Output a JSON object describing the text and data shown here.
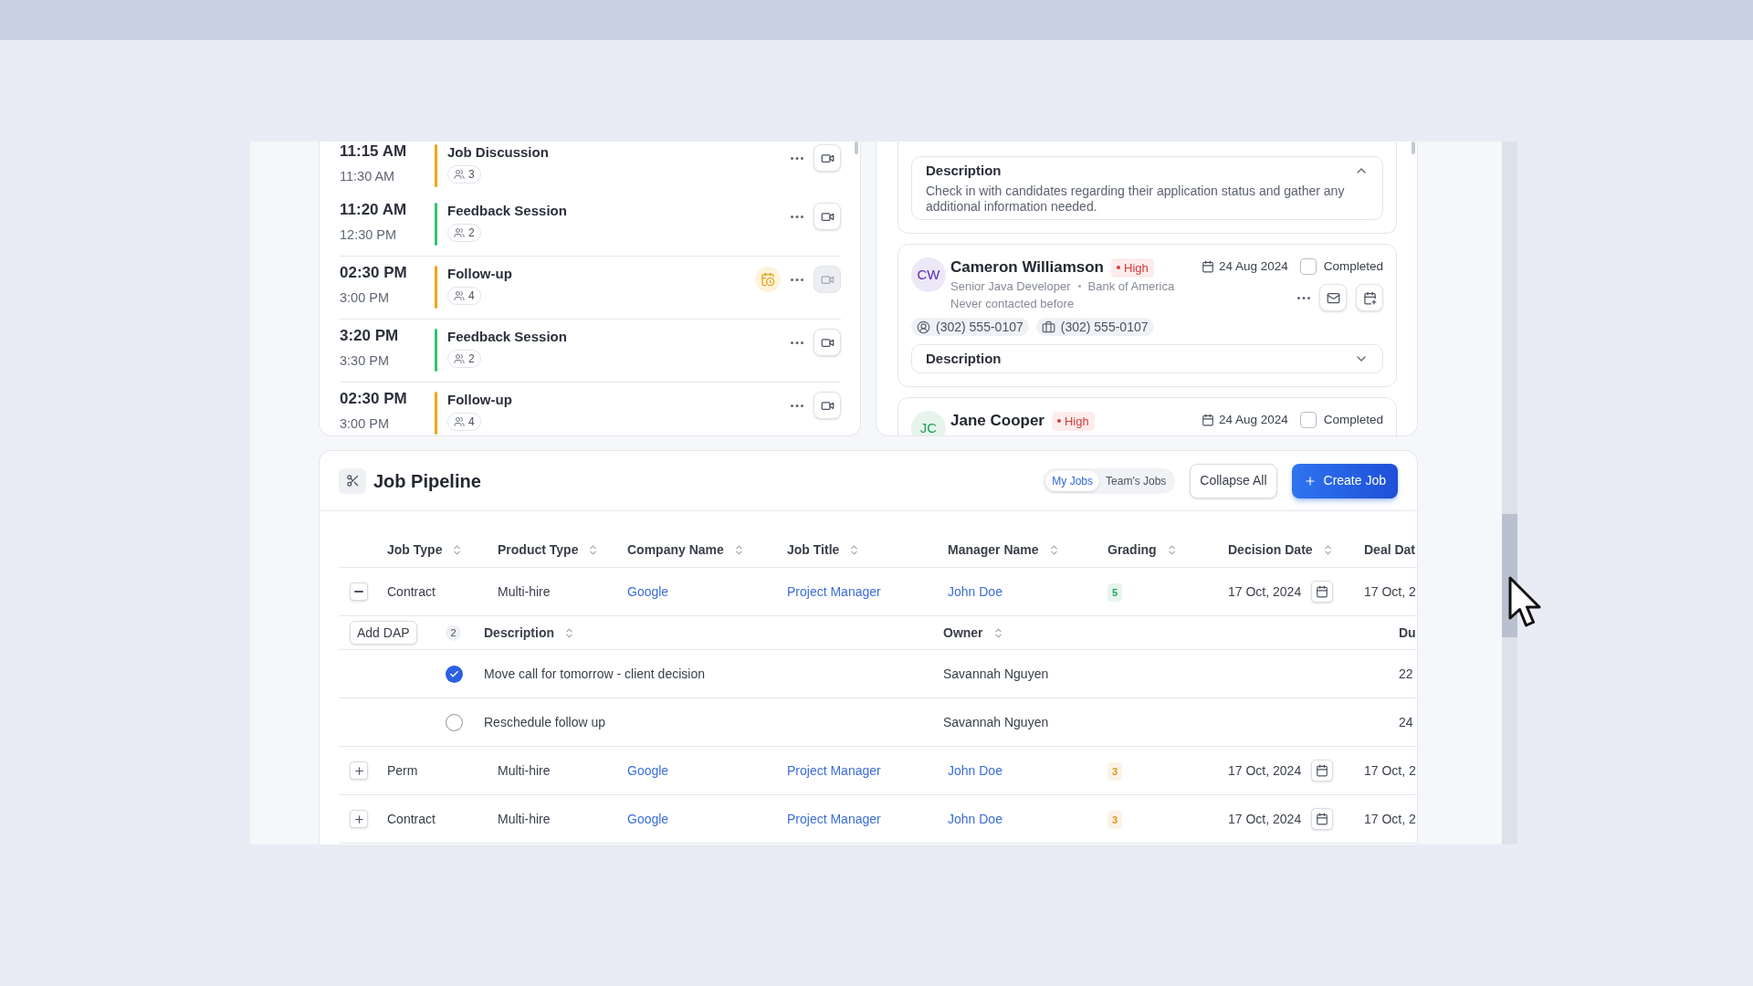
{
  "schedule": {
    "groups": [
      {
        "events": [
          {
            "start": "11:15 AM",
            "end": "11:30 AM",
            "title": "Job Discussion",
            "attendees": "3",
            "color": "#f2a516",
            "flagged": false,
            "video_enabled": true
          },
          {
            "start": "11:20 AM",
            "end": "12:30 PM",
            "title": "Feedback Session",
            "attendees": "2",
            "color": "#2fc46e",
            "flagged": false,
            "video_enabled": true
          }
        ]
      },
      {
        "events": [
          {
            "start": "02:30 PM",
            "end": "3:00 PM",
            "title": "Follow-up",
            "attendees": "4",
            "color": "#f2a516",
            "flagged": true,
            "video_enabled": false
          }
        ]
      },
      {
        "events": [
          {
            "start": "3:20 PM",
            "end": "3:30 PM",
            "title": "Feedback Session",
            "attendees": "2",
            "color": "#2fc46e",
            "flagged": false,
            "video_enabled": true
          }
        ]
      },
      {
        "events": [
          {
            "start": "02:30 PM",
            "end": "3:00 PM",
            "title": "Follow-up",
            "attendees": "4",
            "color": "#f2a516",
            "flagged": false,
            "video_enabled": true
          }
        ]
      }
    ]
  },
  "contacts": {
    "cards": [
      {
        "description": {
          "label": "Description",
          "expanded": true,
          "text": "Check in with candidates regarding their application status and gather any additional information needed."
        }
      },
      {
        "initials": "CW",
        "color": "#5b2bb5",
        "name": "Cameron Williamson",
        "priority": "High",
        "date": "24 Aug 2024",
        "completed": false,
        "completed_label": "Completed",
        "role": "Senior Java Developer",
        "company": "Bank of America",
        "last_contact": "Never contacted before",
        "phones": [
          {
            "kind": "personal",
            "number": "(302) 555-0107"
          },
          {
            "kind": "work",
            "number": "(302) 555-0107"
          }
        ],
        "description": {
          "label": "Description",
          "expanded": false
        }
      },
      {
        "initials": "JC",
        "color": "#1f9d55",
        "name": "Jane Cooper",
        "priority": "High",
        "date": "24 Aug 2024",
        "completed": false,
        "completed_label": "Completed"
      }
    ]
  },
  "pipeline": {
    "title": "Job Pipeline",
    "scopes": [
      {
        "label": "My Jobs",
        "selected": true
      },
      {
        "label": "Team's Jobs",
        "selected": false
      }
    ],
    "actions": [
      {
        "kind": "secondary",
        "label": "Collapse All"
      },
      {
        "kind": "primary",
        "label": "Create Job"
      }
    ],
    "table": {
      "columns": [
        {
          "label": "Job Type",
          "sortable": true
        },
        {
          "label": "Product Type",
          "sortable": true
        },
        {
          "label": "Company Name",
          "sortable": true
        },
        {
          "label": "Job Title",
          "sortable": true
        },
        {
          "label": "Manager Name",
          "sortable": true
        },
        {
          "label": "Grading",
          "sortable": true
        },
        {
          "label": "Decision Date",
          "sortable": true
        },
        {
          "label": "Deal Dat",
          "sortable": false
        }
      ],
      "rows": [
        {
          "expanded": true,
          "job_type": "Contract",
          "product_type": "Multi-hire",
          "company": "Google",
          "job_title": "Project Manager",
          "manager": "John Doe",
          "grading": {
            "value": "5",
            "color": "#22a55a"
          },
          "decision_date": "17 Oct, 2024",
          "deal_date": "17 Oct, 2",
          "dap": {
            "button": "Add DAP",
            "count": "2",
            "columns": [
              {
                "label": "Description",
                "sortable": true
              },
              {
                "label": "Owner",
                "sortable": true
              },
              {
                "label": "Du",
                "sortable": false
              }
            ],
            "items": [
              {
                "checked": true,
                "description": "Move call for tomorrow - client decision",
                "owner": "Savannah Nguyen",
                "due": "22"
              },
              {
                "checked": false,
                "description": "Reschedule follow up",
                "owner": "Savannah Nguyen",
                "due": "24"
              }
            ]
          }
        },
        {
          "expanded": false,
          "job_type": "Perm",
          "product_type": "Multi-hire",
          "company": "Google",
          "job_title": "Project Manager",
          "manager": "John Doe",
          "grading": {
            "value": "3",
            "color": "#e0921a"
          },
          "decision_date": "17 Oct, 2024",
          "deal_date": "17 Oct, 2"
        },
        {
          "expanded": false,
          "job_type": "Contract",
          "product_type": "Multi-hire",
          "company": "Google",
          "job_title": "Project Manager",
          "manager": "John Doe",
          "grading": {
            "value": "3",
            "color": "#e0921a"
          },
          "decision_date": "17 Oct, 2024",
          "deal_date": "17 Oct, 2"
        }
      ]
    }
  }
}
